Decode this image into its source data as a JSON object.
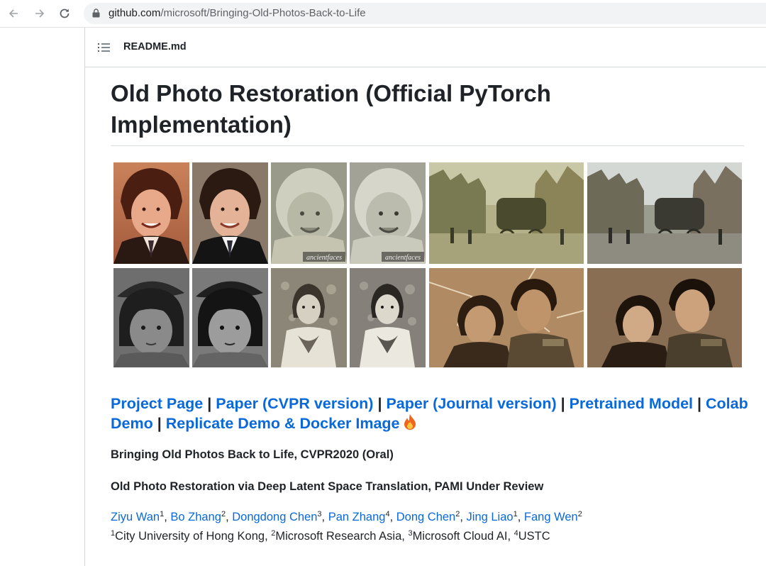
{
  "browser": {
    "url_host": "github.com",
    "url_path": "/microsoft/Bringing-Old-Photos-Back-to-Life"
  },
  "readme": {
    "file_name": "README.md",
    "title": "Old Photo Restoration (Official PyTorch Implementation)"
  },
  "photos": [
    {
      "label": "boy-old"
    },
    {
      "label": "boy-restored"
    },
    {
      "label": "baby-old"
    },
    {
      "label": "baby-restored"
    },
    {
      "label": "street-old"
    },
    {
      "label": "street-restored"
    },
    {
      "label": "girl-bow-old"
    },
    {
      "label": "girl-bow-restored"
    },
    {
      "label": "girl-dress-old"
    },
    {
      "label": "girl-dress-restored"
    },
    {
      "label": "couple-old"
    },
    {
      "label": "couple-restored"
    }
  ],
  "watermark": "ancientfaces",
  "links": {
    "project_page": "Project Page",
    "paper_cvpr": "Paper (CVPR version)",
    "paper_journal": "Paper (Journal version)",
    "pretrained_model": "Pretrained Model",
    "colab_demo": "Colab Demo",
    "replicate_demo": "Replicate Demo & Docker Image",
    "separator": "|"
  },
  "subtitles": {
    "cvpr": "Bringing Old Photos Back to Life, CVPR2020 (Oral)",
    "pami": "Old Photo Restoration via Deep Latent Space Translation, PAMI Under Review"
  },
  "authors": [
    {
      "name": "Ziyu Wan",
      "sup": "1"
    },
    {
      "name": "Bo Zhang",
      "sup": "2"
    },
    {
      "name": "Dongdong Chen",
      "sup": "3"
    },
    {
      "name": "Pan Zhang",
      "sup": "4"
    },
    {
      "name": "Dong Chen",
      "sup": "2"
    },
    {
      "name": "Jing Liao",
      "sup": "1"
    },
    {
      "name": "Fang Wen",
      "sup": "2"
    }
  ],
  "affiliations": [
    {
      "sup": "1",
      "name": "City University of Hong Kong"
    },
    {
      "sup": "2",
      "name": "Microsoft Research Asia"
    },
    {
      "sup": "3",
      "name": "Microsoft Cloud AI"
    },
    {
      "sup": "4",
      "name": "USTC"
    }
  ],
  "colors": {
    "link": "#0969da",
    "text": "#1f2328",
    "border": "#d0d7de"
  }
}
